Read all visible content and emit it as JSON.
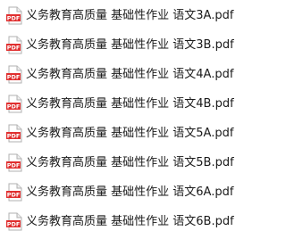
{
  "file_list": {
    "icon": "pdf-file-icon",
    "icon_badge_text": "PDF",
    "icon_color": "#e02f2f",
    "items": [
      {
        "name": "义务教育高质量 基础性作业 语文3A.pdf"
      },
      {
        "name": "义务教育高质量 基础性作业 语文3B.pdf"
      },
      {
        "name": "义务教育高质量 基础性作业 语文4A.pdf"
      },
      {
        "name": "义务教育高质量 基础性作业 语文4B.pdf"
      },
      {
        "name": "义务教育高质量 基础性作业 语文5A.pdf"
      },
      {
        "name": "义务教育高质量 基础性作业 语文5B.pdf"
      },
      {
        "name": "义务教育高质量 基础性作业 语文6A.pdf"
      },
      {
        "name": "义务教育高质量 基础性作业 语文6B.pdf"
      }
    ]
  }
}
